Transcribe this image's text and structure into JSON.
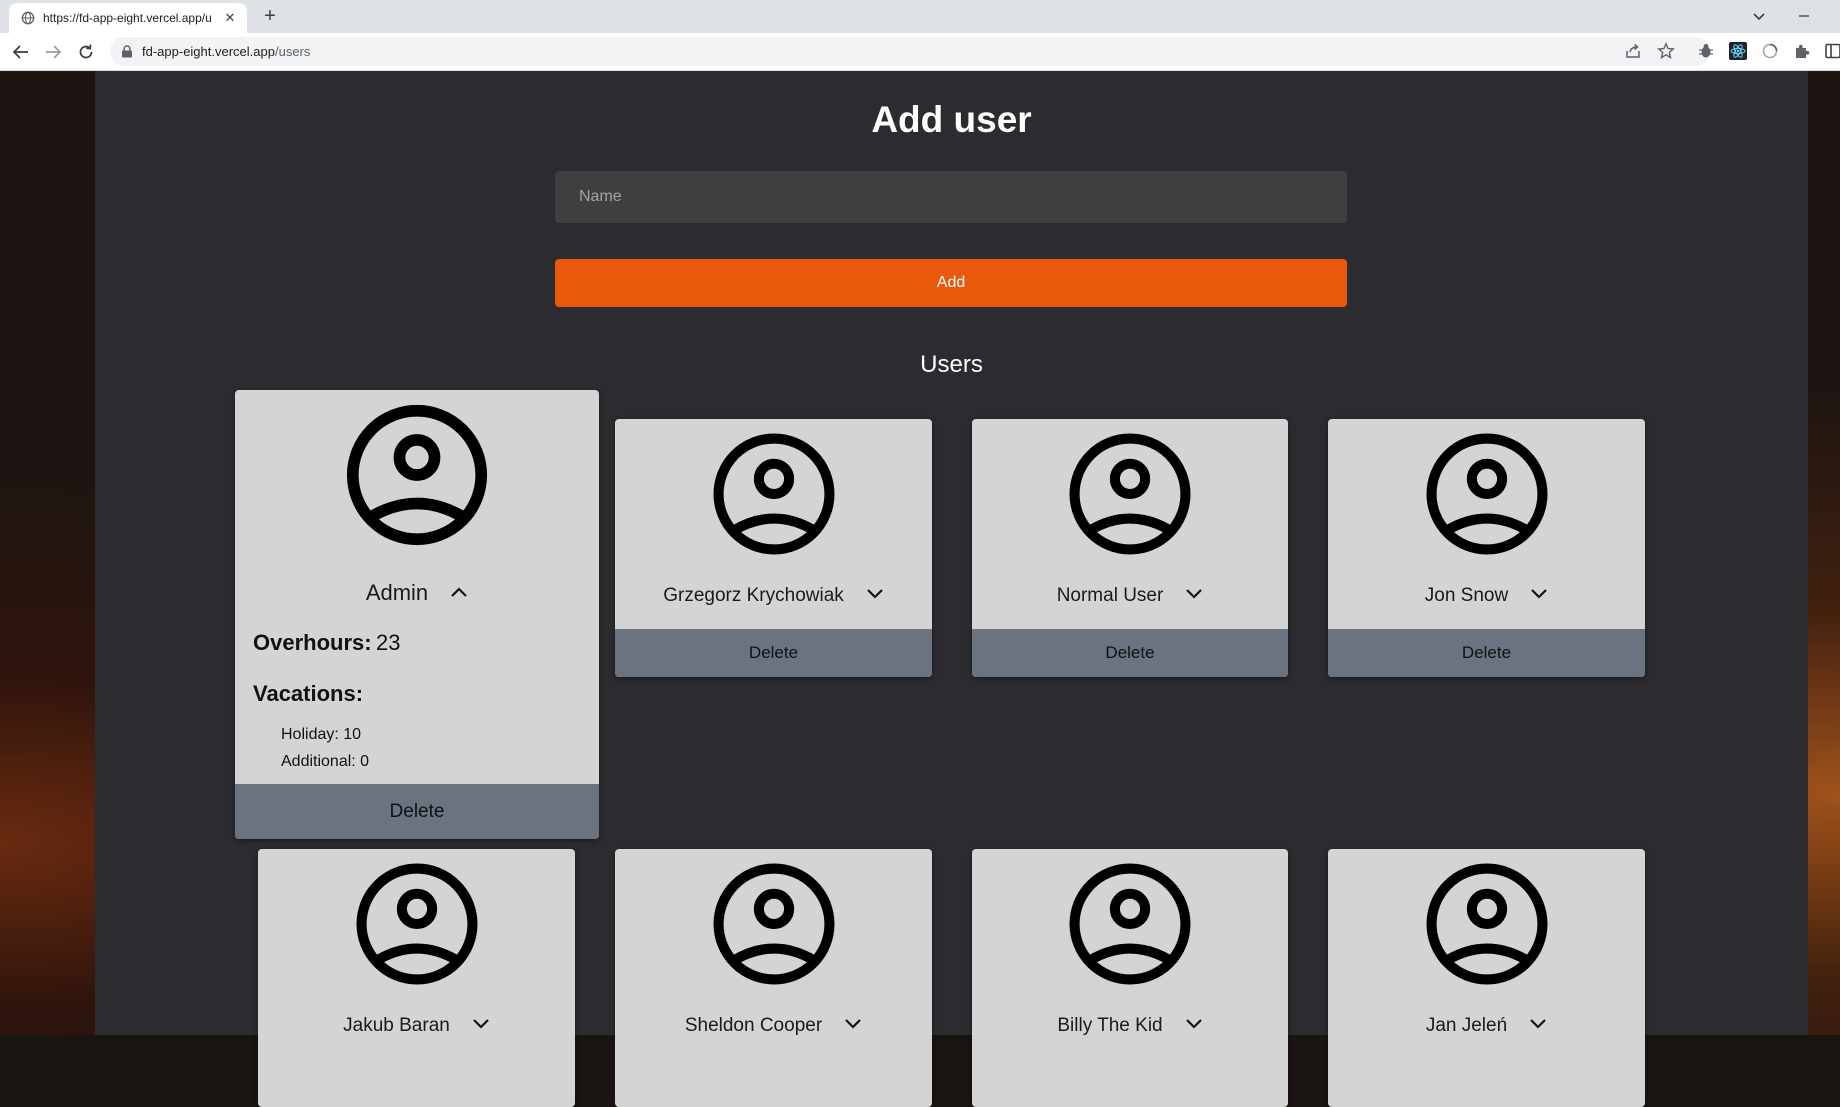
{
  "browser": {
    "tab_title": "https://fd-app-eight.vercel.app/u",
    "url_host": "fd-app-eight.vercel.app",
    "url_path": "/users"
  },
  "page": {
    "title": "Add user",
    "name_placeholder": "Name",
    "name_value": "",
    "add_label": "Add",
    "users_heading": "Users"
  },
  "users": [
    {
      "name": "Admin",
      "expanded": true,
      "overhours_label": "Overhours:",
      "overhours": "23",
      "vacations_label": "Vacations:",
      "holiday": "Holiday: 10",
      "additional": "Additional: 0",
      "delete_label": "Delete"
    },
    {
      "name": "Grzegorz Krychowiak",
      "expanded": false,
      "delete_label": "Delete"
    },
    {
      "name": "Normal User",
      "expanded": false,
      "delete_label": "Delete"
    },
    {
      "name": "Jon Snow",
      "expanded": false,
      "delete_label": "Delete"
    },
    {
      "name": "Jakub Baran",
      "expanded": false
    },
    {
      "name": "Sheldon Cooper",
      "expanded": false
    },
    {
      "name": "Billy The Kid",
      "expanded": false
    },
    {
      "name": "Jan Jeleń",
      "expanded": false
    }
  ],
  "colors": {
    "accent": "#ea580c",
    "panel": "#2c2b30",
    "card": "#d4d4d4",
    "delete_bar": "#6b7280"
  },
  "icons": {
    "avatar": "user-circle-icon",
    "expand": "chevron-down-icon",
    "collapse": "chevron-up-icon"
  }
}
